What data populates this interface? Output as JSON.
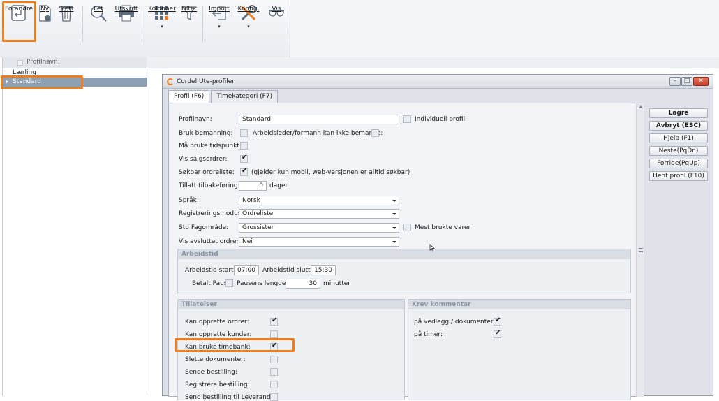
{
  "toolbar": {
    "buttons": [
      {
        "label": "Forandre",
        "icon": "edit-icon"
      },
      {
        "label": "Ny",
        "icon": "new-document-icon"
      },
      {
        "label": "Slett",
        "icon": "trash-icon"
      },
      {
        "label": "Let",
        "icon": "search-icon"
      },
      {
        "label": "Utskrift",
        "icon": "printer-icon"
      },
      {
        "label": "Kolonner",
        "icon": "columns-icon"
      },
      {
        "label": "Filter",
        "icon": "filter-icon"
      },
      {
        "label": "Import",
        "icon": "import-icon"
      },
      {
        "label": "Konfig.",
        "icon": "tools-icon"
      },
      {
        "label": "Vis",
        "icon": "glasses-icon"
      }
    ]
  },
  "list": {
    "header": "Profilnavn:",
    "rows": [
      "Lærling",
      "Standard"
    ]
  },
  "dialog": {
    "title": "Cordel Ute-profiler",
    "tabs": [
      "Profil (F6)",
      "Timekategori (F7)"
    ],
    "profilnavn_label": "Profilnavn:",
    "profilnavn_value": "Standard",
    "individuell_label": "Individuell profil",
    "bruk_bemanning_label": "Bruk bemanning:",
    "arbeidsleder_label": "Arbeidsleder/formann kan ikke bemanne:",
    "ma_bruke_label": "Må bruke tidspunkt:",
    "vis_salgsordrer_label": "Vis salgsordrer:",
    "sokbar_label": "Søkbar ordreliste:",
    "sokbar_note": "(gjelder kun mobil, web-versjonen er alltid søkbar)",
    "tillatt_label": "Tillatt tilbakeføring:",
    "tillatt_value": "0",
    "tillatt_unit": "dager",
    "sprak_label": "Språk:",
    "sprak_value": "Norsk",
    "regmodus_label": "Registreringsmodus:",
    "regmodus_value": "Ordreliste",
    "fagomrade_label": "Std Fagområde:",
    "fagomrade_value": "Grossister",
    "mest_brukte_label": "Mest brukte varer",
    "vis_avsluttet_label": "Vis avsluttet ordrer:",
    "vis_avsluttet_value": "Nei",
    "arbeidstid": {
      "header": "Arbeidstid",
      "start_label": "Arbeidstid start:",
      "start_value": "07:00",
      "slutt_label": "Arbeidstid slutt:",
      "slutt_value": "15:30",
      "betalt_label": "Betalt Pause:",
      "lengde_label": "Pausens lengde:",
      "lengde_value": "30",
      "lengde_unit": "minutter"
    },
    "tillatelser": {
      "header": "Tillatelser",
      "items": [
        {
          "label": "Kan opprette ordrer:",
          "checked": true
        },
        {
          "label": "Kan opprette kunder:",
          "checked": false
        },
        {
          "label": "Kan bruke timebank:",
          "checked": true
        },
        {
          "label": "Slette dokumenter:",
          "checked": false
        },
        {
          "label": "Sende bestilling:",
          "checked": false
        },
        {
          "label": "Registrere bestilling:",
          "checked": false
        },
        {
          "label": "Send bestilling til Leverandør",
          "checked": false
        }
      ]
    },
    "krev": {
      "header": "Krev kommentar",
      "items": [
        {
          "label": "på vedlegg / dokumenter:",
          "checked": true
        },
        {
          "label": "på timer:",
          "checked": true
        }
      ]
    },
    "side_buttons": [
      "Lagre",
      "Avbryt (ESC)",
      "Hjelp (F1)",
      "Neste(PqDn)",
      "Forrige(PqUp)",
      "Hent profil (F10)"
    ]
  },
  "colors": {
    "highlight": "#f07d1c",
    "selected_row": "#8ea0b4"
  }
}
